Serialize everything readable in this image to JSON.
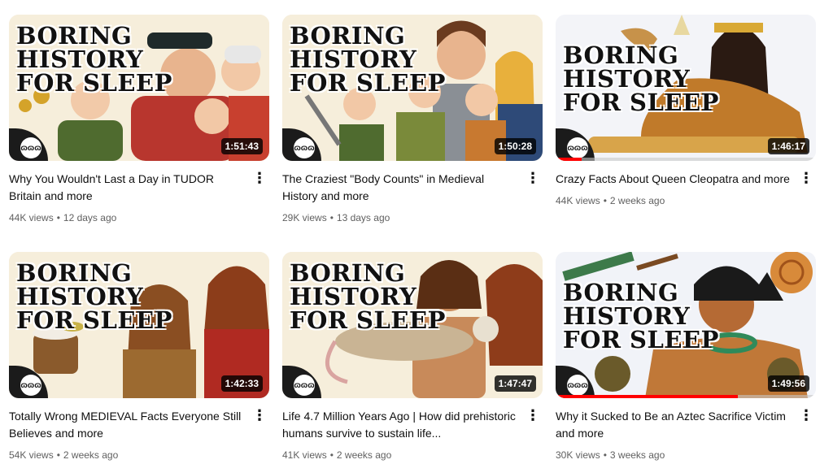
{
  "channel_art_label": "BORING\nHISTORY\nFOR SLEEP",
  "videos": [
    {
      "title": "Why You Wouldn't Last a Day in TUDOR Britain and more",
      "views": "44K views",
      "age": "12 days ago",
      "duration": "1:51:43",
      "watched_fraction": 0
    },
    {
      "title": "The Craziest \"Body Counts\" in Medieval History and more",
      "views": "29K views",
      "age": "13 days ago",
      "duration": "1:50:28",
      "watched_fraction": 0
    },
    {
      "title": "Crazy Facts About Queen Cleopatra and more",
      "views": "44K views",
      "age": "2 weeks ago",
      "duration": "1:46:17",
      "watched_fraction": 0.1
    },
    {
      "title": "Totally Wrong MEDIEVAL Facts Everyone Still Believes and more",
      "views": "54K views",
      "age": "2 weeks ago",
      "duration": "1:42:33",
      "watched_fraction": 0
    },
    {
      "title": "Life 4.7 Million Years Ago | How did prehistoric humans survive to sustain life...",
      "views": "41K views",
      "age": "2 weeks ago",
      "duration": "1:47:47",
      "watched_fraction": 0
    },
    {
      "title": "Why it Sucked to Be an Aztec Sacrifice Victim and more",
      "views": "30K views",
      "age": "3 weeks ago",
      "duration": "1:49:56",
      "watched_fraction": 0.7
    }
  ],
  "separator": "•",
  "more_glyph": "⋮",
  "channel_mark": "ɷɷɷ",
  "colors": {
    "progress": "#ff0000",
    "meta_text": "#606060",
    "duration_bg": "#000000"
  }
}
